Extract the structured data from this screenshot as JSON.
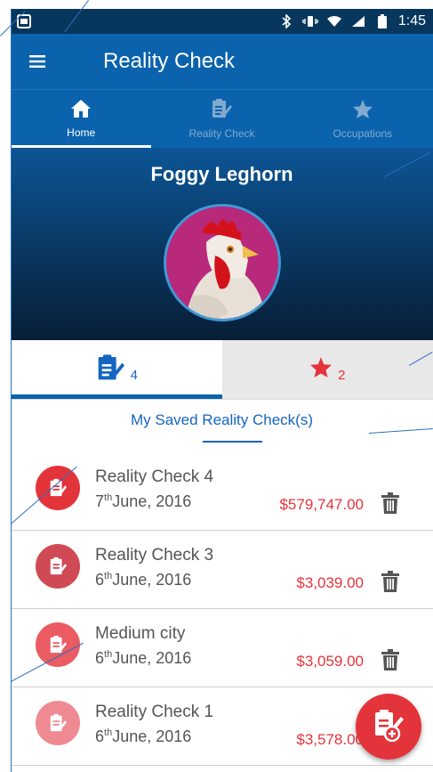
{
  "status_bar": {
    "time": "1:45"
  },
  "app_bar": {
    "title": "Reality Check",
    "menu_icon": "hamburger-menu-icon"
  },
  "tabs": [
    {
      "label": "Home",
      "icon": "home-icon",
      "active": true
    },
    {
      "label": "Reality Check",
      "icon": "clipboard-edit-icon",
      "active": false
    },
    {
      "label": "Occupations",
      "icon": "star-icon",
      "active": false
    }
  ],
  "profile": {
    "name": "Foggy Leghorn"
  },
  "segments": {
    "saved_count": "4",
    "favorites_count": "2"
  },
  "section": {
    "title": "My Saved Reality Check(s)"
  },
  "saved_checks": [
    {
      "name": "Reality Check 4",
      "day": "7",
      "suffix": "th",
      "rest": "June,  2016",
      "amount": "$579,747.00",
      "color": "#e4343b"
    },
    {
      "name": "Reality Check 3",
      "day": "6",
      "suffix": "th",
      "rest": "June,  2016",
      "amount": "$3,039.00",
      "color": "#cf4a55"
    },
    {
      "name": "Medium city",
      "day": "6",
      "suffix": "th",
      "rest": "June,  2016",
      "amount": "$3,059.00",
      "color": "#ea5b63"
    },
    {
      "name": "Reality Check 1",
      "day": "6",
      "suffix": "th",
      "rest": "June,  2016",
      "amount": "$3,578.00",
      "color": "#f08a92"
    }
  ],
  "colors": {
    "primary": "#0b63ad",
    "accent": "#e4343b",
    "statusbar": "#07375c"
  }
}
